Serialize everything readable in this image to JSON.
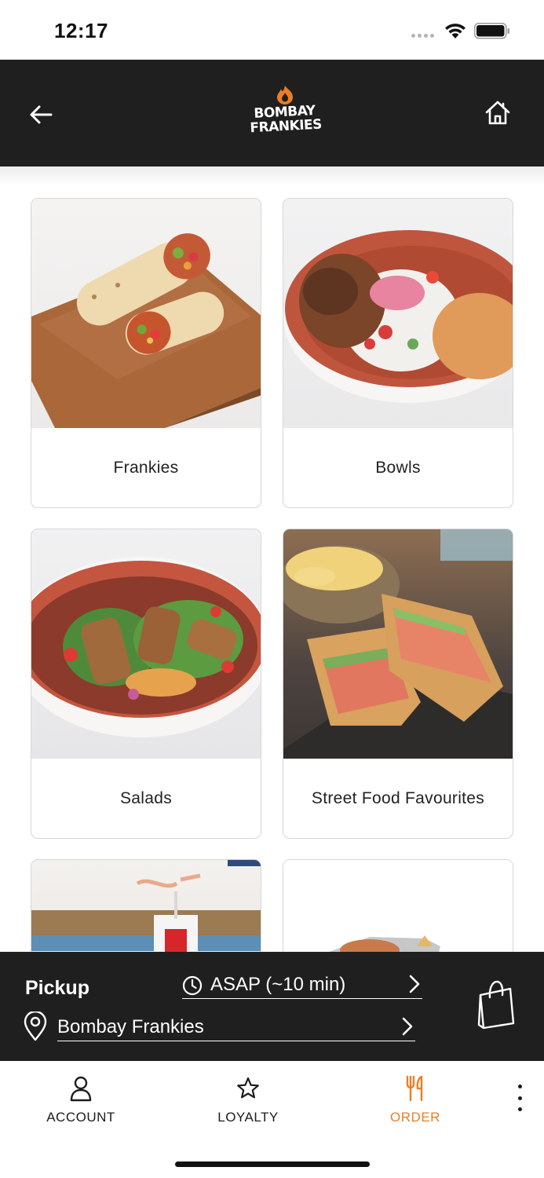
{
  "status_bar": {
    "time": "12:17"
  },
  "header": {
    "logo_line1": "BOMBAY",
    "logo_line2": "FRANKIES",
    "back_icon": "arrow-left-icon",
    "home_icon": "home-icon"
  },
  "menu": {
    "categories": [
      {
        "label": "Frankies"
      },
      {
        "label": "Bowls"
      },
      {
        "label": "Salads"
      },
      {
        "label": "Street Food Favourites"
      },
      {
        "label": ""
      },
      {
        "label": ""
      }
    ]
  },
  "pickup": {
    "label": "Pickup",
    "time": "ASAP (~10 min)",
    "location": "Bombay Frankies"
  },
  "nav": {
    "items": [
      {
        "label": "ACCOUNT",
        "icon": "person-icon"
      },
      {
        "label": "LOYALTY",
        "icon": "star-icon"
      },
      {
        "label": "ORDER",
        "icon": "fork-knife-icon"
      }
    ]
  },
  "colors": {
    "accent": "#ee7d22",
    "header_bg": "#1f1f1f"
  }
}
